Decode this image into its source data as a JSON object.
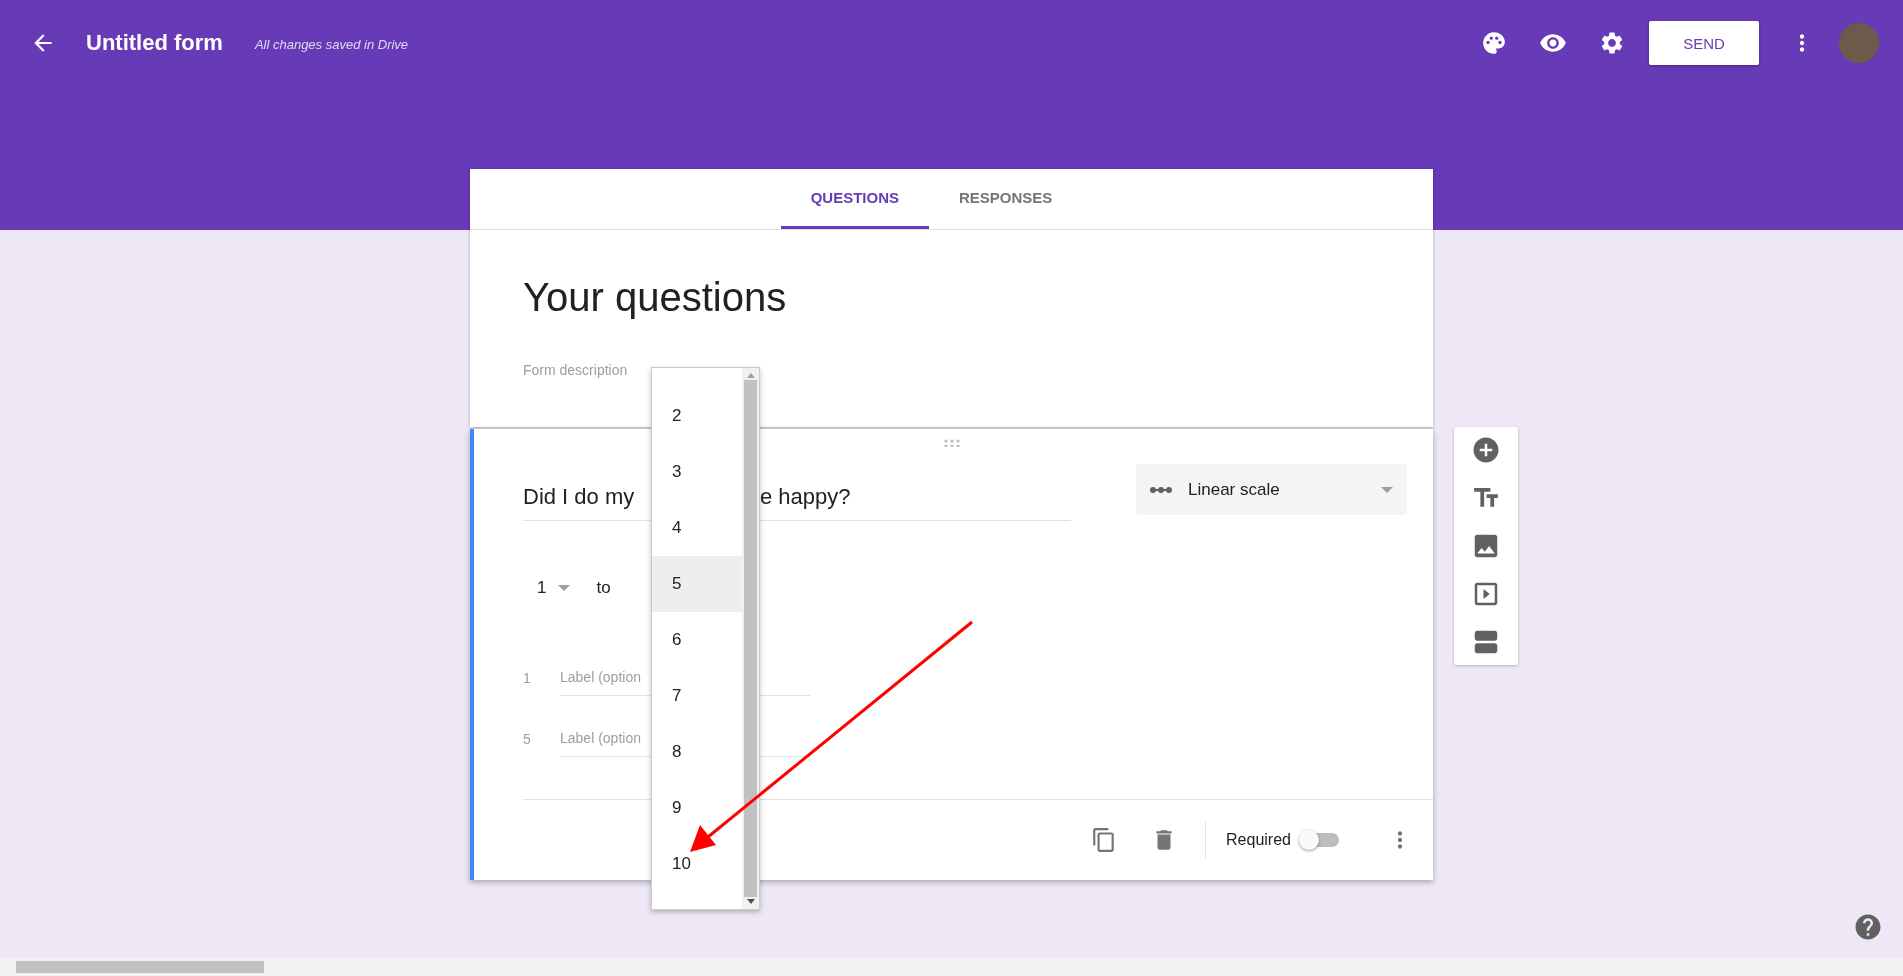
{
  "header": {
    "title": "Untitled form",
    "save_status": "All changes saved in Drive",
    "send_button": "SEND"
  },
  "tabs": [
    {
      "label": "QUESTIONS",
      "selected": true
    },
    {
      "label": "RESPONSES",
      "selected": false
    }
  ],
  "form": {
    "title": "Your questions",
    "description_placeholder": "Form description"
  },
  "question": {
    "title_visible_start": "Did I do my",
    "title_visible_end": "e happy?",
    "type": "Linear scale",
    "scale_from": "1",
    "scale_separator": "to",
    "labels": [
      {
        "number": "1",
        "placeholder": "Label (option"
      },
      {
        "number": "5",
        "placeholder": "Label (option"
      }
    ],
    "required_label": "Required",
    "required": false
  },
  "scale_dropdown": {
    "options": [
      {
        "label": "2",
        "selected": false
      },
      {
        "label": "3",
        "selected": false
      },
      {
        "label": "4",
        "selected": false
      },
      {
        "label": "5",
        "selected": true
      },
      {
        "label": "6",
        "selected": false
      },
      {
        "label": "7",
        "selected": false
      },
      {
        "label": "8",
        "selected": false
      },
      {
        "label": "9",
        "selected": false
      },
      {
        "label": "10",
        "selected": false
      }
    ]
  }
}
